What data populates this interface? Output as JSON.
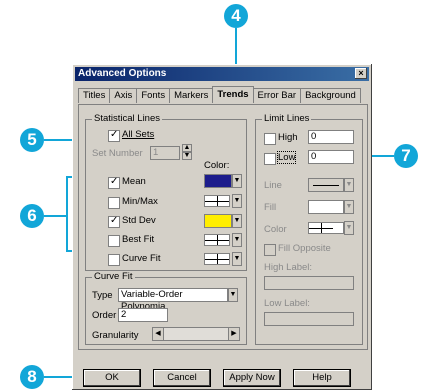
{
  "dialog": {
    "title": "Advanced Options",
    "close_glyph": "×"
  },
  "tabs": [
    "Titles",
    "Axis",
    "Fonts",
    "Markers",
    "Trends",
    "Error Bar",
    "Background"
  ],
  "active_tab": "Trends",
  "statistical_lines": {
    "legend": "Statistical Lines",
    "all_sets": "All Sets",
    "set_number_label": "Set Number",
    "set_number_value": "1",
    "color_label": "Color:",
    "items": [
      {
        "label": "Mean",
        "checked": true,
        "color": "#1c1c8c"
      },
      {
        "label": "Min/Max",
        "checked": false,
        "color": "hatch"
      },
      {
        "label": "Std Dev",
        "checked": true,
        "color": "#ffee00"
      },
      {
        "label": "Best Fit",
        "checked": false,
        "color": "hatch"
      },
      {
        "label": "Curve Fit",
        "checked": false,
        "color": "hatch"
      }
    ]
  },
  "curve_fit": {
    "legend": "Curve Fit",
    "type_label": "Type",
    "type_value": "Variable-Order Polynomia",
    "order_label": "Order",
    "order_value": "2",
    "granularity_label": "Granularity"
  },
  "limit_lines": {
    "legend": "Limit Lines",
    "high_label": "High",
    "high_value": "0",
    "low_label": "Low",
    "low_value": "0",
    "line_label": "Line",
    "fill_label": "Fill",
    "color_label": "Color",
    "fill_opposite_label": "Fill Opposite",
    "high_label_caption": "High Label:",
    "low_label_caption": "Low Label:"
  },
  "buttons": {
    "ok": "OK",
    "cancel": "Cancel",
    "apply": "Apply Now",
    "help": "Help"
  },
  "callouts": [
    "4",
    "5",
    "6",
    "7",
    "8"
  ],
  "accent_color": "#12a6d8"
}
